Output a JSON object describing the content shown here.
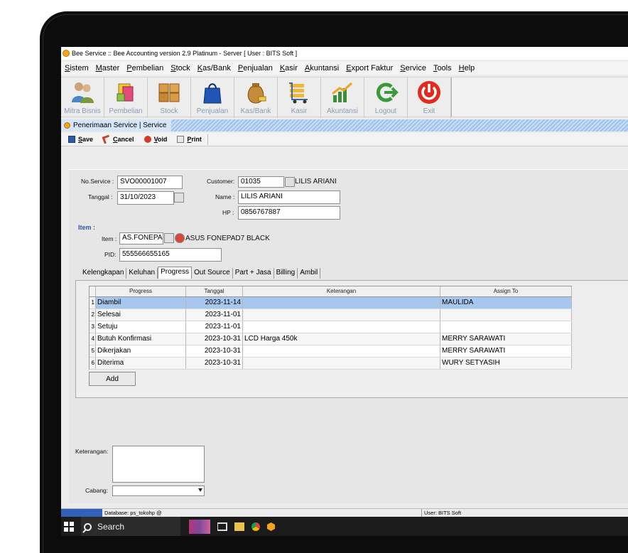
{
  "window": {
    "title": "Bee Service :: Bee Accounting version 2.9 Platinum - Server  [ User : BITS Soft ]"
  },
  "menu": [
    "Sistem",
    "Master",
    "Pembelian",
    "Stock",
    "Kas/Bank",
    "Penjualan",
    "Kasir",
    "Akuntansi",
    "Export Faktur",
    "Service",
    "Tools",
    "Help"
  ],
  "toolbar": [
    {
      "label": "Mitra Bisnis",
      "icon": "users-icon"
    },
    {
      "label": "Pembelian",
      "icon": "purchase-icon"
    },
    {
      "label": "Stock",
      "icon": "boxes-icon"
    },
    {
      "label": "Penjualan",
      "icon": "shopping-bag-icon"
    },
    {
      "label": "Kas/Bank",
      "icon": "money-bag-icon"
    },
    {
      "label": "Kasir",
      "icon": "cashier-icon"
    },
    {
      "label": "Akuntansi",
      "icon": "chart-icon"
    },
    {
      "label": "Logout",
      "icon": "logout-icon"
    },
    {
      "label": "Exit",
      "icon": "power-icon"
    }
  ],
  "form": {
    "title": "Penerimaan Service | Service",
    "actions": {
      "save": "Save",
      "cancel": "Cancel",
      "void": "Void",
      "print": "Print"
    },
    "labels": {
      "no_service": "No.Service :",
      "tanggal": "Tanggal :",
      "customer": "Customer:",
      "name": "Name :",
      "hp": "HP :",
      "item_group": "Item :",
      "item": "Item :",
      "pid": "PID:",
      "keterangan": "Keterangan:",
      "cabang": "Cabang:"
    },
    "values": {
      "no_service": "SVO00001007",
      "tanggal": "31/10/2023",
      "customer_code": "01035",
      "customer_name_display": "LILIS ARIANI",
      "name": "LILIS ARIANI",
      "hp": "0856767887",
      "item_code": "AS.FONEPAD",
      "item_name": "ASUS FONEPAD7 BLACK",
      "pid": "555566655165",
      "keterangan": "",
      "cabang": ""
    },
    "tabs": [
      "Kelengkapan",
      "Keluhan",
      "Progress",
      "Out Source",
      "Part + Jasa",
      "Billing",
      "Ambil"
    ],
    "active_tab": "Progress",
    "grid": {
      "headers": [
        "Progress",
        "Tanggal",
        "Keterangan",
        "Assign To"
      ],
      "rows": [
        {
          "no": "1",
          "progress": "Diambil",
          "tanggal": "2023-11-14",
          "keterangan": "",
          "assign": "MAULIDA"
        },
        {
          "no": "2",
          "progress": "Selesai",
          "tanggal": "2023-11-01",
          "keterangan": "",
          "assign": ""
        },
        {
          "no": "3",
          "progress": "Setuju",
          "tanggal": "2023-11-01",
          "keterangan": "",
          "assign": ""
        },
        {
          "no": "4",
          "progress": "Butuh Konfirmasi",
          "tanggal": "2023-10-31",
          "keterangan": "LCD Harga 450k",
          "assign": "MERRY SARAWATI"
        },
        {
          "no": "5",
          "progress": "Dikerjakan",
          "tanggal": "2023-10-31",
          "keterangan": "",
          "assign": "MERRY SARAWATI"
        },
        {
          "no": "6",
          "progress": "Diterima",
          "tanggal": "2023-10-31",
          "keterangan": "",
          "assign": "WURY SETYASIH"
        }
      ]
    },
    "add_button": "Add"
  },
  "statusbar": {
    "database": "Database: ps_tokohp @",
    "user": "User: BITS Soft"
  },
  "taskbar": {
    "search": "Search"
  },
  "colors": {
    "selected_row": "#a7c7ef",
    "status_blue": "#3261b7",
    "accent_orange": "#f2a51c"
  }
}
